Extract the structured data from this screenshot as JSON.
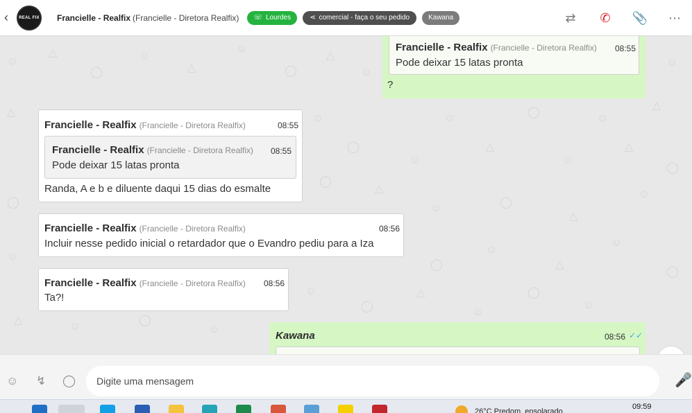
{
  "header": {
    "contact_name": "Francielle - Realfix",
    "contact_sub": "(Francielle - Diretora Realfix)",
    "avatar_text": "REAL FIX",
    "tags": [
      {
        "label": "Lourdes",
        "icon": "whatsapp-icon",
        "color": "#25b33f"
      },
      {
        "label": "comercial - faça o seu pedido",
        "icon": "sitemap-icon",
        "color": "#4f4f4f"
      },
      {
        "label": "Kawana",
        "icon": "",
        "color": "#7b7b7b"
      }
    ],
    "actions": [
      "transfer-icon",
      "end-call-icon",
      "attach-icon",
      "more-icon"
    ]
  },
  "messages": [
    {
      "direction": "out",
      "quoted": {
        "author": "Francielle - Realfix",
        "role": "(Francielle - Diretora Realfix)",
        "time": "08:55",
        "text": "Pode deixar 15 latas pronta"
      },
      "text": "?"
    },
    {
      "direction": "in",
      "author": "Francielle - Realfix",
      "role": "(Francielle - Diretora Realfix)",
      "time": "08:55",
      "quoted": {
        "author": "Francielle - Realfix",
        "role": "(Francielle - Diretora Realfix)",
        "time": "08:55",
        "text": "Pode deixar 15 latas pronta"
      },
      "text": "Randa, A e b e diluente daqui 15 dias do esmalte"
    },
    {
      "direction": "in",
      "author": "Francielle - Realfix",
      "role": "(Francielle - Diretora Realfix)",
      "time": "08:56",
      "text": "Incluir nesse pedido inicial o retardador que o Evandro pediu para a Iza"
    },
    {
      "direction": "in",
      "author": "Francielle - Realfix",
      "role": "(Francielle - Diretora Realfix)",
      "time": "08:56",
      "text": "Ta?!"
    },
    {
      "direction": "out",
      "author": "Kawana",
      "time": "08:56",
      "status": "read"
    }
  ],
  "composer": {
    "placeholder": "Digite uma mensagem",
    "left_icons": [
      "emoji-icon",
      "quick-reply-icon",
      "chat-icon"
    ],
    "right_icon": "microphone-icon"
  },
  "taskbar": {
    "clock": "09:59",
    "weather_text": "26°C  Predom. ensolarado"
  },
  "colors": {
    "accent_green": "#25b33f",
    "outgoing_bubble": "#d6f7c4",
    "alert_red": "#d8262d"
  }
}
